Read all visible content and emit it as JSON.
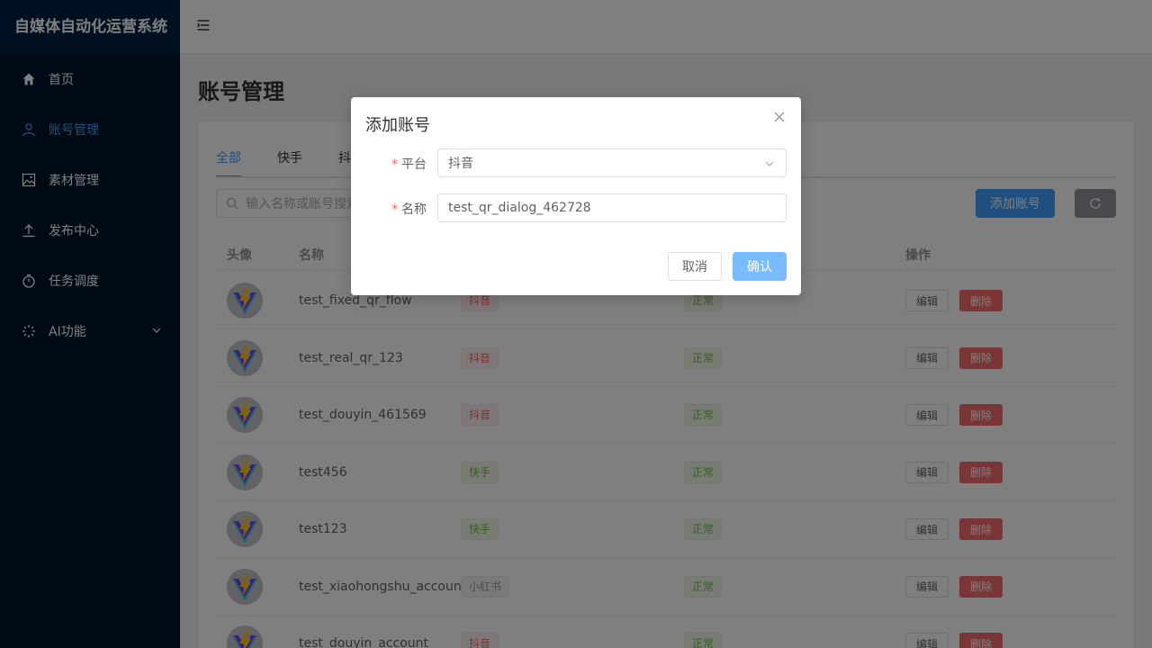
{
  "app": {
    "title": "自媒体自动化运营系统"
  },
  "sidebar": {
    "items": [
      {
        "label": "首页",
        "icon": "home-icon",
        "active": false
      },
      {
        "label": "账号管理",
        "icon": "user-icon",
        "active": true
      },
      {
        "label": "素材管理",
        "icon": "picture-icon",
        "active": false
      },
      {
        "label": "发布中心",
        "icon": "upload-icon",
        "active": false
      },
      {
        "label": "任务调度",
        "icon": "timer-icon",
        "active": false
      },
      {
        "label": "AI功能",
        "icon": "loading-icon",
        "active": false
      }
    ]
  },
  "page": {
    "title": "账号管理"
  },
  "tabs": [
    "全部",
    "快手",
    "抖"
  ],
  "search": {
    "placeholder": "输入名称或账号搜索"
  },
  "toolbar": {
    "add_label": "添加账号"
  },
  "table": {
    "headers": {
      "avatar": "头像",
      "name": "名称",
      "actions": "操作"
    },
    "rows": [
      {
        "name": "test_fixed_qr_flow",
        "platform": "抖音",
        "platform_type": "douyin",
        "status": "正常"
      },
      {
        "name": "test_real_qr_123",
        "platform": "抖音",
        "platform_type": "douyin",
        "status": "正常"
      },
      {
        "name": "test_douyin_461569",
        "platform": "抖音",
        "platform_type": "douyin",
        "status": "正常"
      },
      {
        "name": "test456",
        "platform": "快手",
        "platform_type": "kuaishou",
        "status": "正常"
      },
      {
        "name": "test123",
        "platform": "快手",
        "platform_type": "kuaishou",
        "status": "正常"
      },
      {
        "name": "test_xiaohongshu_account",
        "platform": "小红书",
        "platform_type": "xhs",
        "status": "正常"
      },
      {
        "name": "test_douyin_account",
        "platform": "抖音",
        "platform_type": "douyin",
        "status": "正常"
      }
    ],
    "edit_label": "编辑",
    "delete_label": "删除"
  },
  "dialog": {
    "title": "添加账号",
    "platform_label": "平台",
    "platform_value": "抖音",
    "name_label": "名称",
    "name_value": "test_qr_dialog_462728",
    "cancel_label": "取消",
    "confirm_label": "确认"
  },
  "colors": {
    "sidebar_bg": "#001529",
    "primary": "#409eff",
    "danger": "#f56c6c",
    "success": "#67c23a"
  }
}
